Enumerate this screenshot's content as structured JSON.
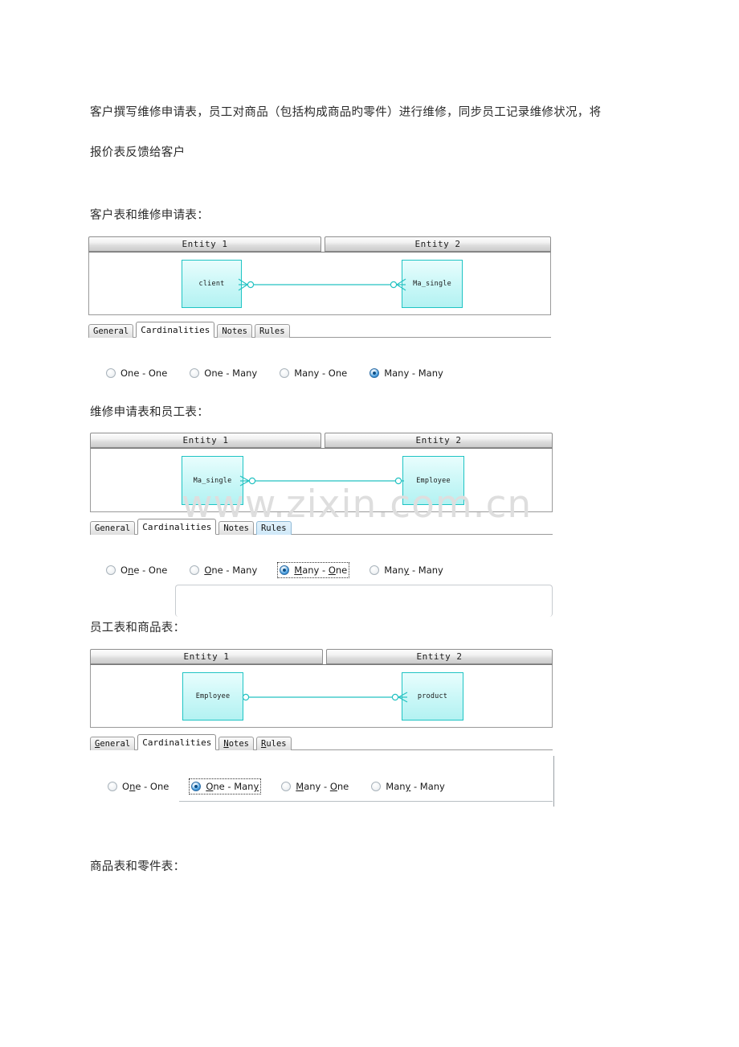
{
  "document": {
    "intro_line1": "客户撰写维修申请表，员工对商品（包括构成商品旳零件）进行维修，同步员工记录维修状况，将",
    "intro_line2": "报价表反馈给客户",
    "watermark": "www.zixin.com.cn"
  },
  "sections": [
    {
      "caption": "客户表和维修申请表：",
      "headers": {
        "entity1": "Entity 1",
        "entity2": "Entity 2"
      },
      "entity1_label": "client",
      "entity2_label": "Ma_single",
      "relationship": "Many - Many",
      "left_end": "crowsfoot-circle",
      "right_end": "crowsfoot-circle",
      "tabs": [
        {
          "label": "General",
          "state": "normal"
        },
        {
          "label": "Cardinalities",
          "state": "active"
        },
        {
          "label": "Notes",
          "state": "normal"
        },
        {
          "label": "Rules",
          "state": "normal"
        }
      ],
      "radios": [
        {
          "label": "One - One",
          "selected": false,
          "focused": false
        },
        {
          "label": "One - Many",
          "selected": false,
          "focused": false
        },
        {
          "label": "Many - One",
          "selected": false,
          "focused": false
        },
        {
          "label": "Many - Many",
          "selected": true,
          "focused": false
        }
      ]
    },
    {
      "caption": "维修申请表和员工表：",
      "headers": {
        "entity1": "Entity 1",
        "entity2": "Entity 2"
      },
      "entity1_label": "Ma_single",
      "entity2_label": "Employee",
      "relationship": "Many - One",
      "left_end": "crowsfoot-circle",
      "right_end": "circle",
      "tabs": [
        {
          "label": "General",
          "state": "normal"
        },
        {
          "label": "Cardinalities",
          "state": "active"
        },
        {
          "label": "Notes",
          "state": "normal"
        },
        {
          "label": "Rules",
          "state": "hover"
        }
      ],
      "radios": [
        {
          "label": "One - One",
          "selected": false,
          "focused": false,
          "mnemonic": 2
        },
        {
          "label": "One - Many",
          "selected": false,
          "focused": false,
          "mnemonic": 0
        },
        {
          "label": "Many - One",
          "selected": true,
          "focused": true,
          "mnemonic": 0
        },
        {
          "label": "Many - Many",
          "selected": false,
          "focused": false,
          "mnemonic": 3
        }
      ]
    },
    {
      "caption": "员工表和商品表：",
      "headers": {
        "entity1": "Entity 1",
        "entity2": "Entity 2"
      },
      "entity1_label": "Employee",
      "entity2_label": "product",
      "relationship": "One - Many",
      "left_end": "circle",
      "right_end": "crowsfoot-circle",
      "tabs": [
        {
          "label": "General",
          "state": "normal"
        },
        {
          "label": "Cardinalities",
          "state": "active"
        },
        {
          "label": "Notes",
          "state": "normal"
        },
        {
          "label": "Rules",
          "state": "normal"
        }
      ],
      "radios": [
        {
          "label": "One - One",
          "selected": false,
          "focused": false,
          "mnemonic": 2
        },
        {
          "label": "One - Many",
          "selected": true,
          "focused": true,
          "mnemonic": 0
        },
        {
          "label": "Many - One",
          "selected": false,
          "focused": false,
          "mnemonic": 0
        },
        {
          "label": "Many - Many",
          "selected": false,
          "focused": false,
          "mnemonic": 3
        }
      ]
    }
  ],
  "footer_caption": "商品表和零件表："
}
